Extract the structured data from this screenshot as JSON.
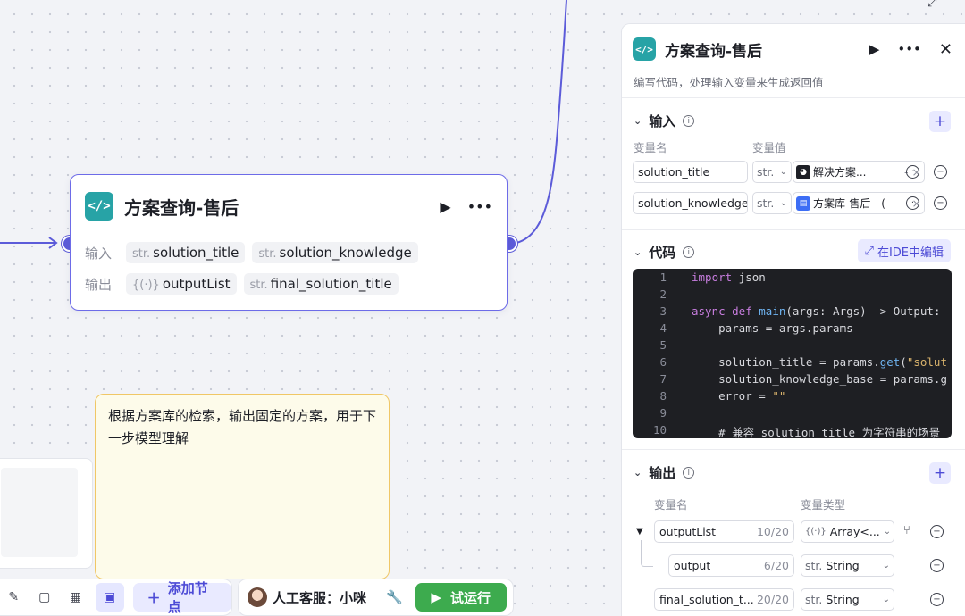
{
  "node": {
    "title": "方案查询-售后",
    "input_label": "输入",
    "output_label": "输出",
    "inputs": [
      {
        "type": "str.",
        "name": "solution_title"
      },
      {
        "type": "str.",
        "name": "solution_knowledge"
      }
    ],
    "outputs": [
      {
        "type": "{(·)}",
        "name": "outputList"
      },
      {
        "type": "str.",
        "name": "final_solution_title"
      }
    ]
  },
  "note": {
    "text": "根据方案库的检索，输出固定的方案，用于下一步模型理解"
  },
  "toolbar": {
    "add_node_label": "添加节点",
    "agent_label": "人工客服：小咪",
    "run_label": "试运行"
  },
  "panel": {
    "title": "方案查询-售后",
    "description": "编写代码，处理输入变量来生成返回值",
    "input_section": {
      "title": "输入",
      "col_name": "变量名",
      "col_value": "变量值",
      "rows": [
        {
          "name": "solution_title",
          "type": "str.",
          "ref_text": "解决方案...",
          "ref_suffix": "- ×",
          "ref_color": "#1d1f26",
          "ref_icon": "robot-icon"
        },
        {
          "name": "solution_knowledge",
          "type": "str.",
          "ref_text": "方案库-售后 - (",
          "ref_suffix": "×",
          "ref_color": "#3d6ef5",
          "ref_icon": "database-icon"
        }
      ]
    },
    "code_section": {
      "title": "代码",
      "ide_label": "在IDE中编辑",
      "lines": [
        {
          "n": "1",
          "code": "import json"
        },
        {
          "n": "2",
          "code": ""
        },
        {
          "n": "3",
          "code": "async def main(args: Args) -> Output:"
        },
        {
          "n": "4",
          "code": "    params = args.params"
        },
        {
          "n": "5",
          "code": ""
        },
        {
          "n": "6",
          "code": "    solution_title = params.get(\"solut"
        },
        {
          "n": "7",
          "code": "    solution_knowledge_base = params.g"
        },
        {
          "n": "8",
          "code": "    error = \"\""
        },
        {
          "n": "9",
          "code": ""
        },
        {
          "n": "10",
          "code": "    # 兼容 solution_title 为字符串的场景"
        }
      ]
    },
    "output_section": {
      "title": "输出",
      "col_name": "变量名",
      "col_type": "变量类型",
      "rows": [
        {
          "name": "outputList",
          "count": "10/20",
          "type_icon": "{(·)}",
          "type": "Array<..."
        },
        {
          "name": "output",
          "count": "6/20",
          "type_icon": "str.",
          "type": "String"
        },
        {
          "name": "final_solution_t...",
          "count": "20/20",
          "type_icon": "str.",
          "type": "String"
        }
      ]
    }
  }
}
